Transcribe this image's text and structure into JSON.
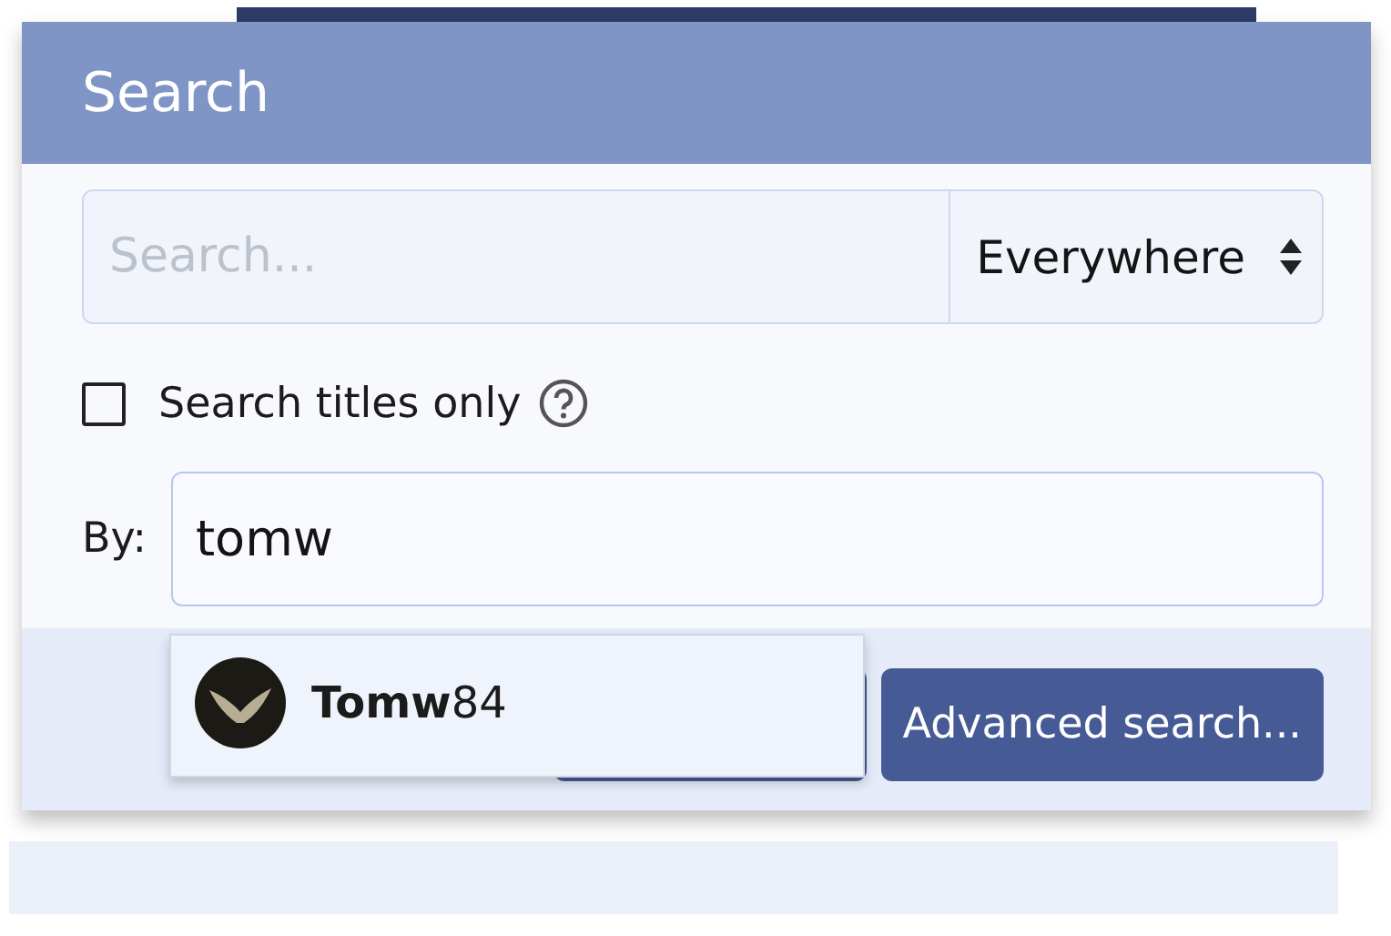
{
  "dialog": {
    "title": "Search"
  },
  "search": {
    "placeholder": "Search...",
    "scope": "Everywhere"
  },
  "titles_only": {
    "label": "Search titles only",
    "checked": false
  },
  "by": {
    "label": "By:",
    "value": "tomw"
  },
  "suggestions": [
    {
      "text": "**Tomw**84"
    }
  ],
  "buttons": [
    {
      "kind": "covered"
    },
    {
      "kind": "advanced",
      "label": "Advanced search..."
    }
  ]
}
